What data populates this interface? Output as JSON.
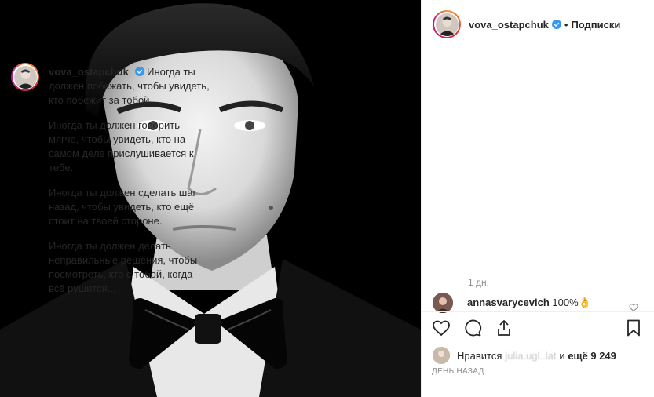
{
  "post": {
    "username": "vova_ostapchuk",
    "follow_label": "Подписки",
    "dot": "•",
    "caption_paragraphs": [
      "Иногда ты должен побежать, чтобы увидеть, кто побежит за тобой.",
      "Иногда ты должен говорить мягче, чтобы увидеть, кто на самом деле прислушивается к тебе.",
      "Иногда ты должен сделать шаг назад, чтобы увидеть, кто ещё стоит на твоей стороне.",
      "Иногда ты должен делать неправильные решения, чтобы посмотреть, кто с тобой, когда всё рушится..."
    ],
    "caption_time": "1 дн."
  },
  "comment": {
    "username": "annasvarycevich",
    "text": "100%👌"
  },
  "likes": {
    "prefix": "Нравится",
    "blurred_user": "julia.ugl..lat",
    "suffix": "и",
    "count_label": "ещё 9 249"
  },
  "date_label": "ДЕНЬ НАЗАД",
  "icons": [
    "heart-icon",
    "comment-icon",
    "share-icon",
    "bookmark-icon",
    "verified-icon"
  ],
  "colors": {
    "verified": "#3897f0",
    "text": "#262626",
    "muted": "#8e8e8e"
  }
}
